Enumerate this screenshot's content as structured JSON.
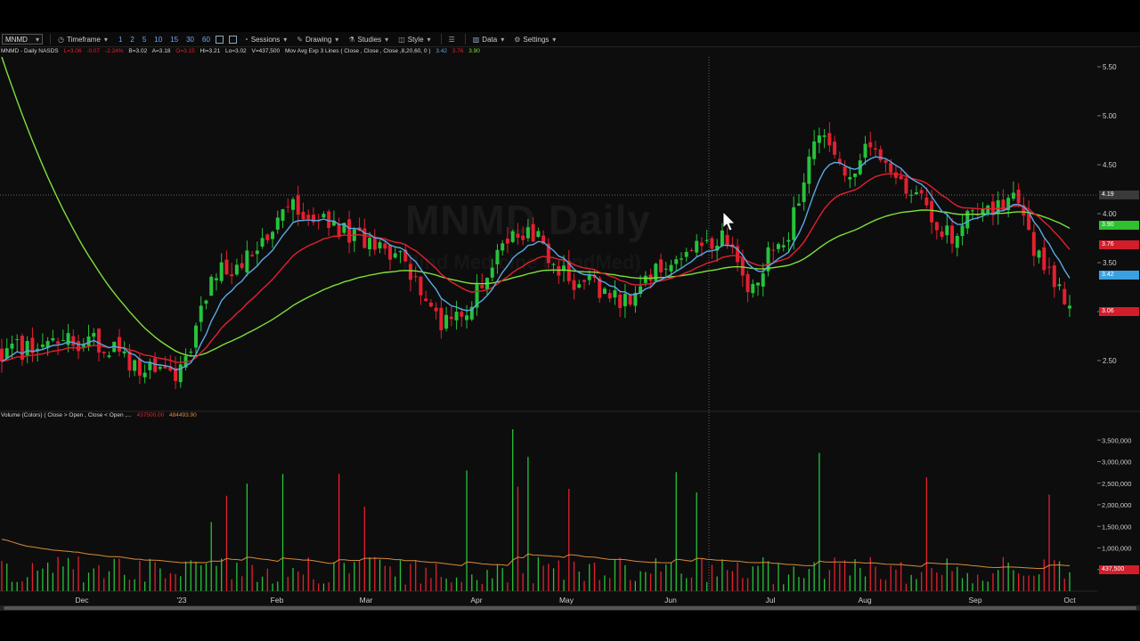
{
  "toolbar": {
    "symbol": "MNMD",
    "timeframe_label": "Timeframe",
    "timeframes": [
      "1",
      "2",
      "5",
      "10",
      "15",
      "30",
      "60"
    ],
    "sessions_label": "Sessions",
    "drawing_label": "Drawing",
    "studies_label": "Studies",
    "style_label": "Style",
    "data_label": "Data",
    "settings_label": "Settings"
  },
  "legend_price": {
    "title": "MNMD - Daily  NASDS",
    "last": "L=3.06",
    "change": "-0.07",
    "pct": "-2.24%",
    "bid": "B=3.02",
    "ask": "A=3.18",
    "open": "O=3.15",
    "high": "Hi=3.21",
    "low": "Lo=3.02",
    "vol": "V=437,500",
    "study": "Mov Avg Exp 3 Lines ( Close , Close , Close ,8,20,60, 0 )",
    "ma_fast": "3.42",
    "ma_mid": "3.76",
    "ma_slow": "3.90"
  },
  "legend_volume": {
    "title": "Volume (Colors) ( Close > Open , Close < Open ,...",
    "vol": "437500.00",
    "avg": "484493.90"
  },
  "watermark": {
    "title": "MNMD Daily",
    "subtitle": "Mind Medicine (MindMed)"
  },
  "colors": {
    "up": "#27c23b",
    "down": "#e3202f",
    "ma_fast": "#5aa9e6",
    "ma_mid": "#e3202f",
    "ma_slow": "#7fe03a",
    "vol_avg": "#d98a3a"
  },
  "price_tags": {
    "crosshair": "4.19",
    "ma_slow": "3.90",
    "ma_mid": "3.76",
    "ma_fast": "3.42",
    "last": "3.06",
    "volume_last": "437,500"
  },
  "chart_data": {
    "type": "candlestick",
    "title": "MNMD - Daily",
    "x_tick_labels": [
      "Dec",
      "'23",
      "Feb",
      "Mar",
      "Apr",
      "May",
      "Jun",
      "Jul",
      "Aug",
      "Sep",
      "Oct"
    ],
    "price_axis": {
      "ticks": [
        "5.50",
        "5.00",
        "4.50",
        "4.00",
        "3.50",
        "3.00",
        "2.50"
      ],
      "range": [
        2.0,
        5.6
      ]
    },
    "volume_axis": {
      "ticks": [
        "3,500,000",
        "3,000,000",
        "2,500,000",
        "2,000,000",
        "1,500,000",
        "1,000,000",
        "500,000"
      ],
      "range": [
        0,
        4000000
      ]
    },
    "close_anchors": [
      {
        "month": "Nov",
        "close": 2.6
      },
      {
        "month": "Dec",
        "close": 2.7
      },
      {
        "month": "'23",
        "close": 2.35
      },
      {
        "month": "Jan",
        "close": 3.45
      },
      {
        "month": "Feb",
        "close": 4.05
      },
      {
        "month": "Mar",
        "close": 3.6
      },
      {
        "month": "Apr",
        "close": 2.9
      },
      {
        "month": "Apr-mid",
        "close": 3.8
      },
      {
        "month": "May",
        "close": 3.3
      },
      {
        "month": "May-end",
        "close": 3.1
      },
      {
        "month": "Jun",
        "close": 3.6
      },
      {
        "month": "Jun-mid",
        "close": 3.75
      },
      {
        "month": "Jun-end",
        "close": 3.3
      },
      {
        "month": "Jul",
        "close": 3.6
      },
      {
        "month": "Jul-mid",
        "close": 4.8
      },
      {
        "month": "Jul-end",
        "close": 4.3
      },
      {
        "month": "Aug",
        "close": 4.75
      },
      {
        "month": "Aug-mid",
        "close": 4.3
      },
      {
        "month": "Aug-end",
        "close": 3.8
      },
      {
        "month": "Sep",
        "close": 4.0
      },
      {
        "month": "Sep-mid",
        "close": 4.15
      },
      {
        "month": "Sep-end",
        "close": 3.45
      },
      {
        "month": "Oct",
        "close": 3.06
      }
    ],
    "last_price": 3.06,
    "last_volume": 437500,
    "volume_average": 484494
  }
}
